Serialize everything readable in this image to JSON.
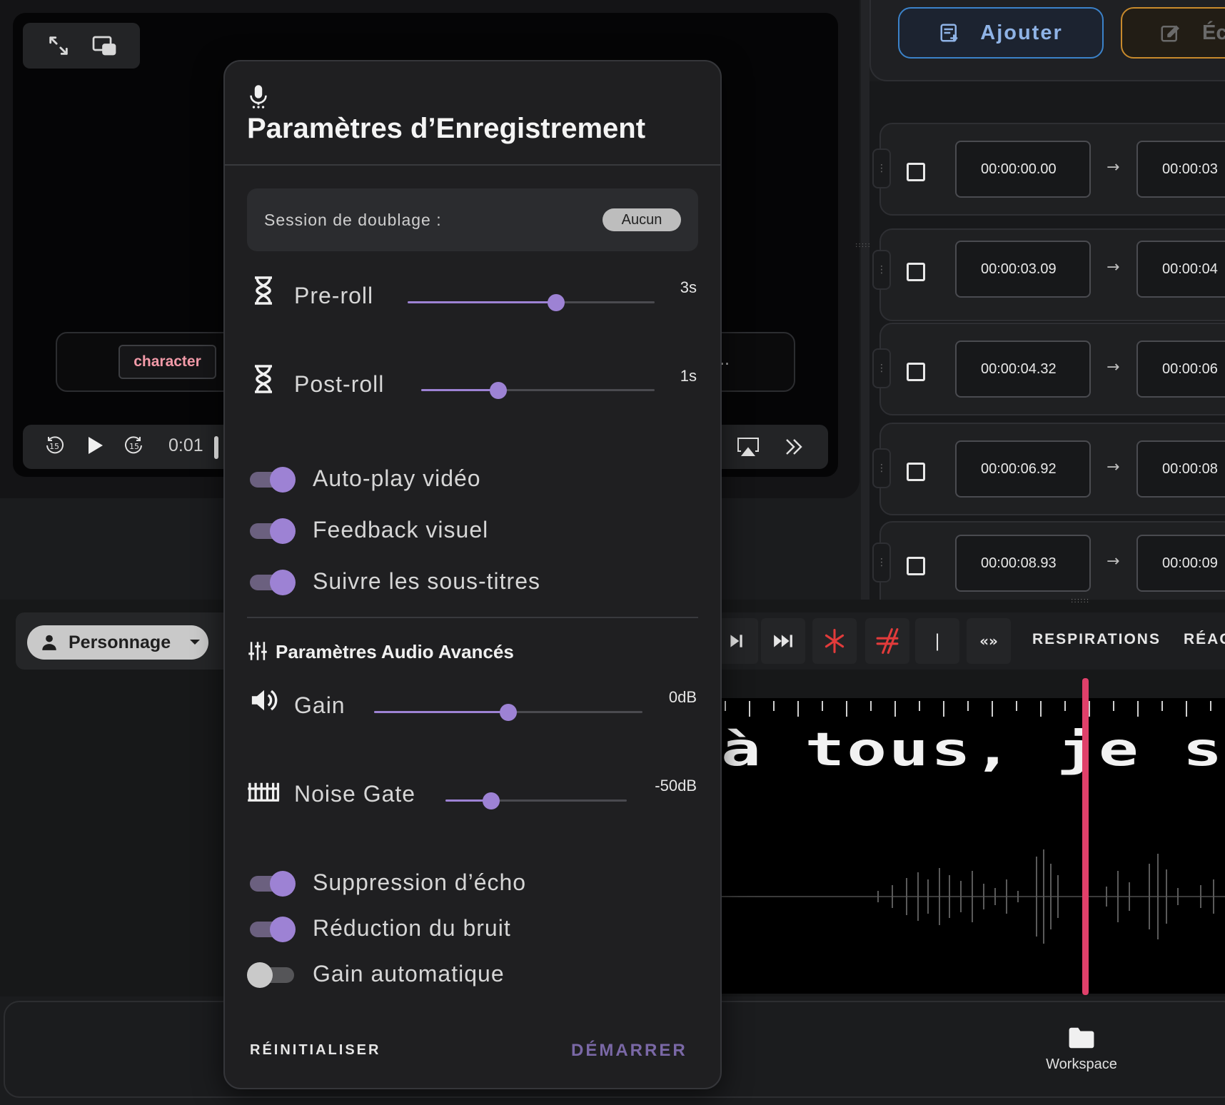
{
  "video": {
    "subtitle_character": "character",
    "subtitle_overflow": "..",
    "time": "0:01",
    "skip_back_seconds": "15",
    "skip_forward_seconds": "15"
  },
  "top_actions": {
    "add_label": "Ajouter",
    "write_label": "Éc"
  },
  "subtitle_rows": [
    {
      "start": "00:00:00.00",
      "end": "00:00:03",
      "arrow": "→"
    },
    {
      "start": "00:00:03.09",
      "end": "00:00:04",
      "arrow": "→"
    },
    {
      "start": "00:00:04.32",
      "end": "00:00:06",
      "arrow": "→"
    },
    {
      "start": "00:00:06.92",
      "end": "00:00:08",
      "arrow": "→"
    },
    {
      "start": "00:00:08.93",
      "end": "00:00:09",
      "arrow": "→"
    }
  ],
  "lower_toolbar": {
    "character_select": "Personnage",
    "separator_glyph": "|",
    "chevrons_glyph": "«»",
    "breaths_label": "RESPIRATIONS",
    "reactions_label": "RÉAC"
  },
  "waveform": {
    "subtitle_text": "à tous, je su"
  },
  "bottom_bar": {
    "workspace_label": "Workspace"
  },
  "dialog": {
    "title": "Paramètres d’Enregistrement",
    "session_label": "Session de doublage :",
    "session_value": "Aucun",
    "preroll": {
      "label": "Pre-roll",
      "value_text": "3s",
      "fraction": 0.6
    },
    "postroll": {
      "label": "Post-roll",
      "value_text": "1s",
      "fraction": 0.33
    },
    "toggles": [
      {
        "label": "Auto-play vidéo",
        "on": true
      },
      {
        "label": "Feedback visuel",
        "on": true
      },
      {
        "label": "Suivre les sous-titres",
        "on": true
      }
    ],
    "advanced_title": "Paramètres Audio Avancés",
    "gain": {
      "label": "Gain",
      "value_text": "0dB",
      "fraction": 0.5
    },
    "noise_gate": {
      "label": "Noise Gate",
      "value_text": "-50dB",
      "fraction": 0.25
    },
    "advanced_toggles": [
      {
        "label": "Suppression d’écho",
        "on": true
      },
      {
        "label": "Réduction du bruit",
        "on": true
      },
      {
        "label": "Gain automatique",
        "on": false
      }
    ],
    "reset_label": "RÉINITIALISER",
    "start_label": "DÉMARRER"
  },
  "colors": {
    "accent": "#9d82d4",
    "playhead": "#e0406a",
    "add_button_border": "#3b82c9",
    "write_button_border": "#c88a2c",
    "character_tag_text": "#f29aa8"
  }
}
